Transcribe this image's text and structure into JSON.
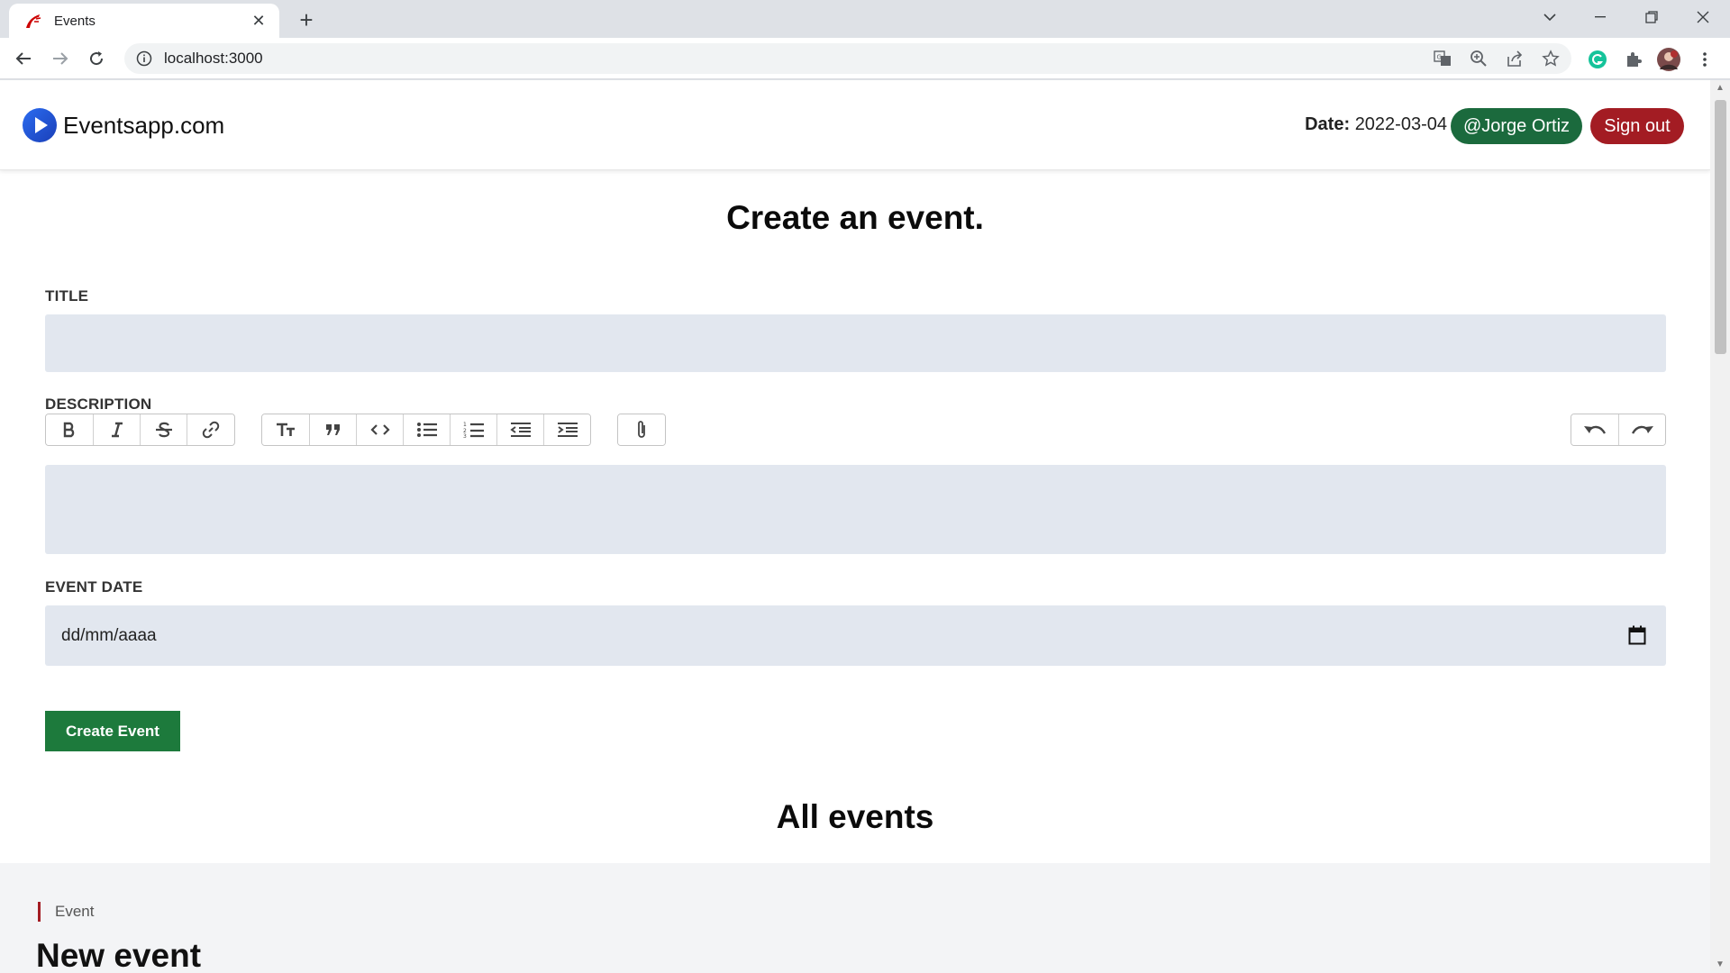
{
  "browser": {
    "tab_title": "Events",
    "url": "localhost:3000"
  },
  "header": {
    "brand": "Eventsapp.com",
    "date_label": "Date:",
    "date_value": "2022-03-04",
    "user": "@Jorge Ortiz",
    "signout": "Sign out"
  },
  "form": {
    "title": "Create an event.",
    "title_label": "TITLE",
    "description_label": "DESCRIPTION",
    "event_date_label": "EVENT DATE",
    "event_date_placeholder": "dd/mm/aaaa",
    "submit": "Create Event",
    "toolbar": {
      "text_tools": [
        "bold-icon",
        "italic-icon",
        "strikethrough-icon",
        "link-icon"
      ],
      "block_tools": [
        "heading-icon",
        "quote-icon",
        "code-icon",
        "bullet-list-icon",
        "numbered-list-icon",
        "decrease-indent-icon",
        "increase-indent-icon"
      ],
      "file_tools": [
        "attach-icon"
      ],
      "history_tools": [
        "undo-icon",
        "redo-icon"
      ]
    }
  },
  "events": {
    "heading": "All events",
    "items": [
      {
        "tag": "Event",
        "title": "New event"
      }
    ]
  },
  "colors": {
    "brand_green": "#1b6a3d",
    "signout_red": "#a31c23",
    "input_bg": "#e2e7ef",
    "create_btn": "#1d7a3c"
  }
}
